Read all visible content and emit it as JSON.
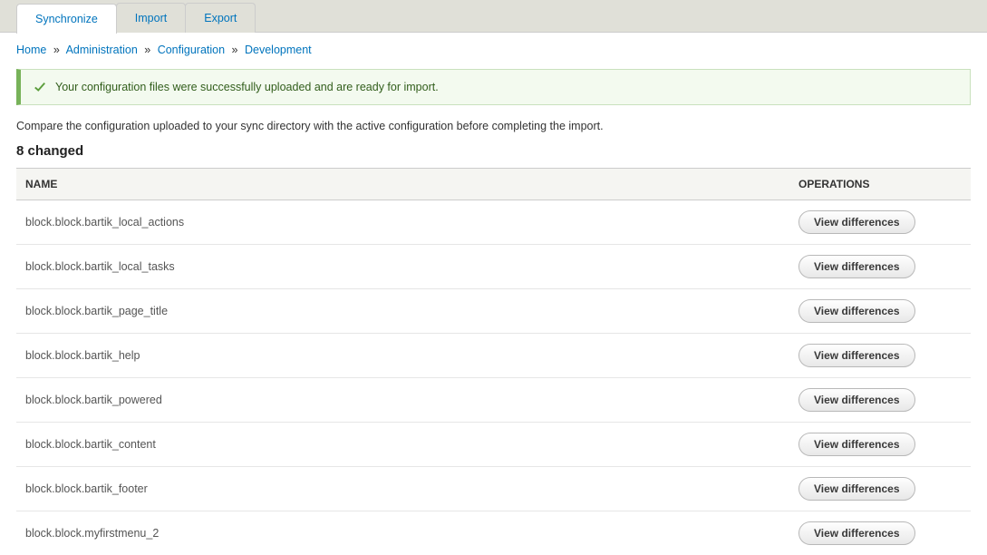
{
  "tabs": [
    {
      "label": "Synchronize",
      "active": true
    },
    {
      "label": "Import",
      "active": false
    },
    {
      "label": "Export",
      "active": false
    }
  ],
  "breadcrumb": {
    "items": [
      "Home",
      "Administration",
      "Configuration",
      "Development"
    ],
    "sep": "»"
  },
  "message": {
    "text": "Your configuration files were successfully uploaded and are ready for import."
  },
  "description": "Compare the configuration uploaded to your sync directory with the active configuration before completing the import.",
  "heading": "8 changed",
  "table": {
    "headers": {
      "name": "NAME",
      "operations": "OPERATIONS"
    },
    "button_label": "View differences",
    "rows": [
      {
        "name": "block.block.bartik_local_actions"
      },
      {
        "name": "block.block.bartik_local_tasks"
      },
      {
        "name": "block.block.bartik_page_title"
      },
      {
        "name": "block.block.bartik_help"
      },
      {
        "name": "block.block.bartik_powered"
      },
      {
        "name": "block.block.bartik_content"
      },
      {
        "name": "block.block.bartik_footer"
      },
      {
        "name": "block.block.myfirstmenu_2"
      }
    ]
  }
}
